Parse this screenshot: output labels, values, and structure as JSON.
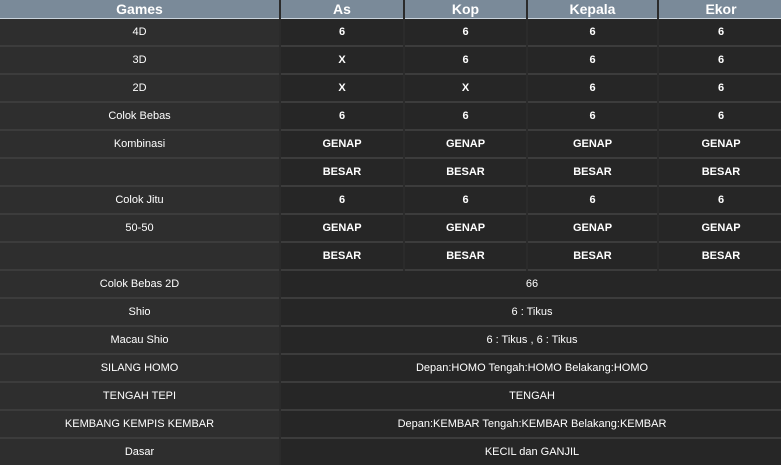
{
  "header": [
    "Games",
    "As",
    "Kop",
    "Kepala",
    "Ekor"
  ],
  "rows": [
    {
      "label": "4D",
      "cells": [
        "6",
        "6",
        "6",
        "6"
      ]
    },
    {
      "label": "3D",
      "cells": [
        "X",
        "6",
        "6",
        "6"
      ]
    },
    {
      "label": "2D",
      "cells": [
        "X",
        "X",
        "6",
        "6"
      ]
    },
    {
      "label": "Colok Bebas",
      "cells": [
        "6",
        "6",
        "6",
        "6"
      ]
    },
    {
      "label": "Kombinasi",
      "cells": [
        "GENAP",
        "GENAP",
        "GENAP",
        "GENAP"
      ]
    },
    {
      "label": "",
      "cells": [
        "BESAR",
        "BESAR",
        "BESAR",
        "BESAR"
      ]
    },
    {
      "label": "Colok Jitu",
      "cells": [
        "6",
        "6",
        "6",
        "6"
      ]
    },
    {
      "label": "50-50",
      "cells": [
        "GENAP",
        "GENAP",
        "GENAP",
        "GENAP"
      ]
    },
    {
      "label": "",
      "cells": [
        "BESAR",
        "BESAR",
        "BESAR",
        "BESAR"
      ]
    }
  ],
  "wide_rows": [
    {
      "label": "Colok Bebas 2D",
      "value": "66"
    },
    {
      "label": "Shio",
      "value": "6 : Tikus"
    },
    {
      "label": "Macau Shio",
      "value": "6 : Tikus , 6 : Tikus"
    },
    {
      "label": "SILANG HOMO",
      "value": "Depan:HOMO Tengah:HOMO Belakang:HOMO"
    },
    {
      "label": "TENGAH TEPI",
      "value": "TENGAH"
    },
    {
      "label": "KEMBANG KEMPIS KEMBAR",
      "value": "Depan:KEMBAR Tengah:KEMBAR Belakang:KEMBAR"
    },
    {
      "label": "Dasar",
      "value": "KECIL dan GANJIL"
    }
  ]
}
